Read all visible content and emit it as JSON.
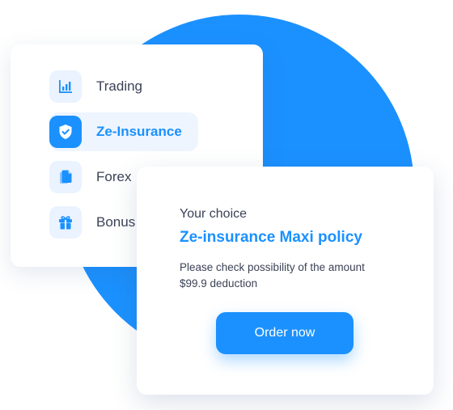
{
  "colors": {
    "accent": "#1b91ff",
    "text": "#3b4256",
    "icon_bg": "#eaf3ff",
    "active_bg": "#eef5ff"
  },
  "menu": {
    "items": [
      {
        "label": "Trading",
        "icon": "bar-chart-icon",
        "active": false
      },
      {
        "label": "Ze-Insurance",
        "icon": "shield-check-icon",
        "active": true
      },
      {
        "label": "Forex",
        "icon": "documents-icon",
        "active": false
      },
      {
        "label": "Bonus",
        "icon": "gift-icon",
        "active": false
      }
    ]
  },
  "choice": {
    "caption": "Your choice",
    "title": "Ze-insurance Maxi policy",
    "description": "Please check possibility of the amount $99.9 deduction",
    "button_label": "Order now"
  }
}
